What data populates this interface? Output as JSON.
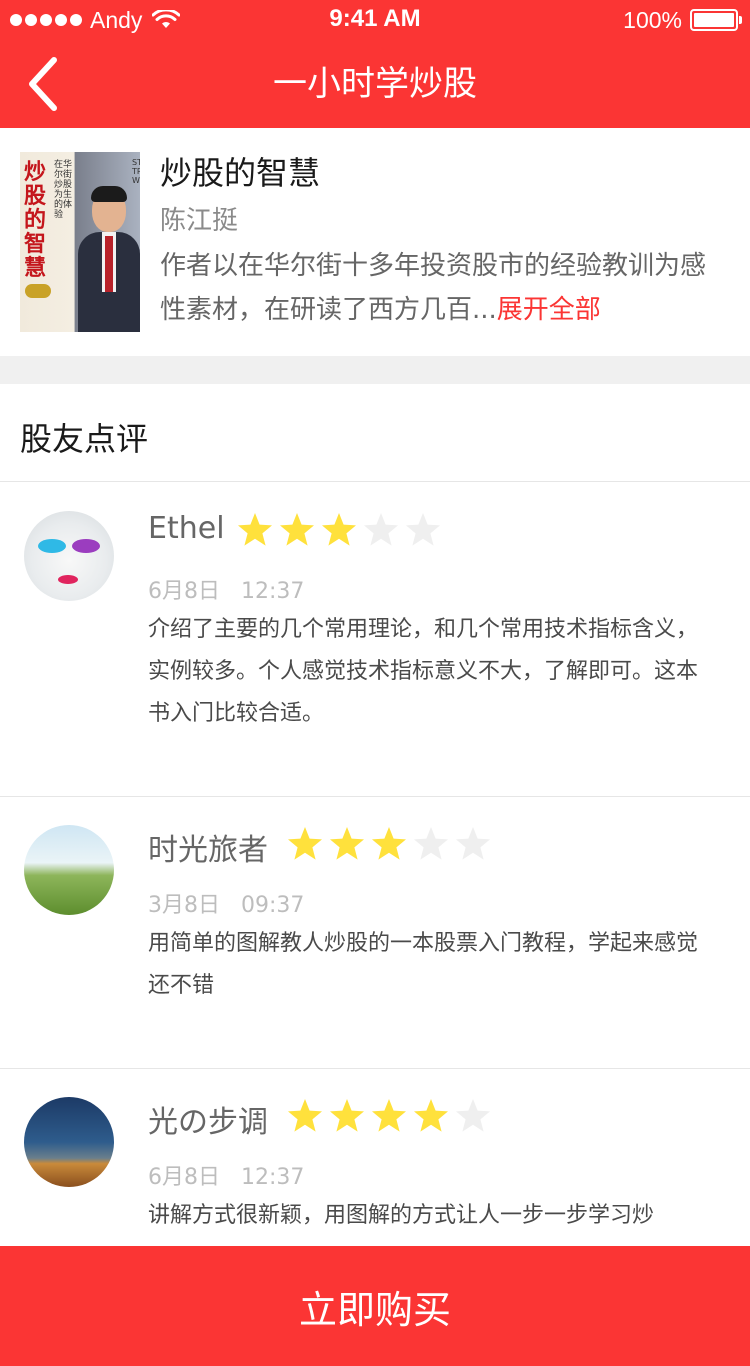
{
  "status_bar": {
    "carrier": "Andy",
    "time": "9:41 AM",
    "battery": "100%",
    "icons": [
      "signal-dots-icon",
      "wifi-icon",
      "battery-icon"
    ]
  },
  "nav": {
    "title": "一小时学炒股",
    "back_icon": "chevron-left-icon"
  },
  "book": {
    "title": "炒股的智慧",
    "author": "陈江挺",
    "description": "作者以在华尔街十多年投资股市的经验教训为感性素材，在研读了西方几百...",
    "expand_label": "展开全部",
    "cover": {
      "title": "炒股的智慧",
      "subtitle": "在华尔街炒股为生的体验",
      "english": "STOCK TRADING WISDOM"
    }
  },
  "reviews_section": {
    "title": "股友点评"
  },
  "reviews": [
    {
      "name": "Ethel",
      "rating": 3,
      "max_rating": 5,
      "date": "6月8日",
      "time": "12:37",
      "text": "介绍了主要的几个常用理论，和几个常用技术指标含义，实例较多。个人感觉技术指标意义不大，了解即可。这本书入门比较合适。"
    },
    {
      "name": "时光旅者",
      "rating": 3,
      "max_rating": 5,
      "date": "3月8日",
      "time": "09:37",
      "text": "用简单的图解教人炒股的一本股票入门教程，学起来感觉还不错"
    },
    {
      "name": "光の步调",
      "rating": 4,
      "max_rating": 5,
      "date": "6月8日",
      "time": "12:37",
      "text": "讲解方式很新颖，用图解的方式让人一步一步学习炒"
    }
  ],
  "buy_button": {
    "label": "立即购买"
  },
  "colors": {
    "accent": "#fb3534",
    "star_on": "#ffe13c",
    "star_off": "#efefef"
  }
}
